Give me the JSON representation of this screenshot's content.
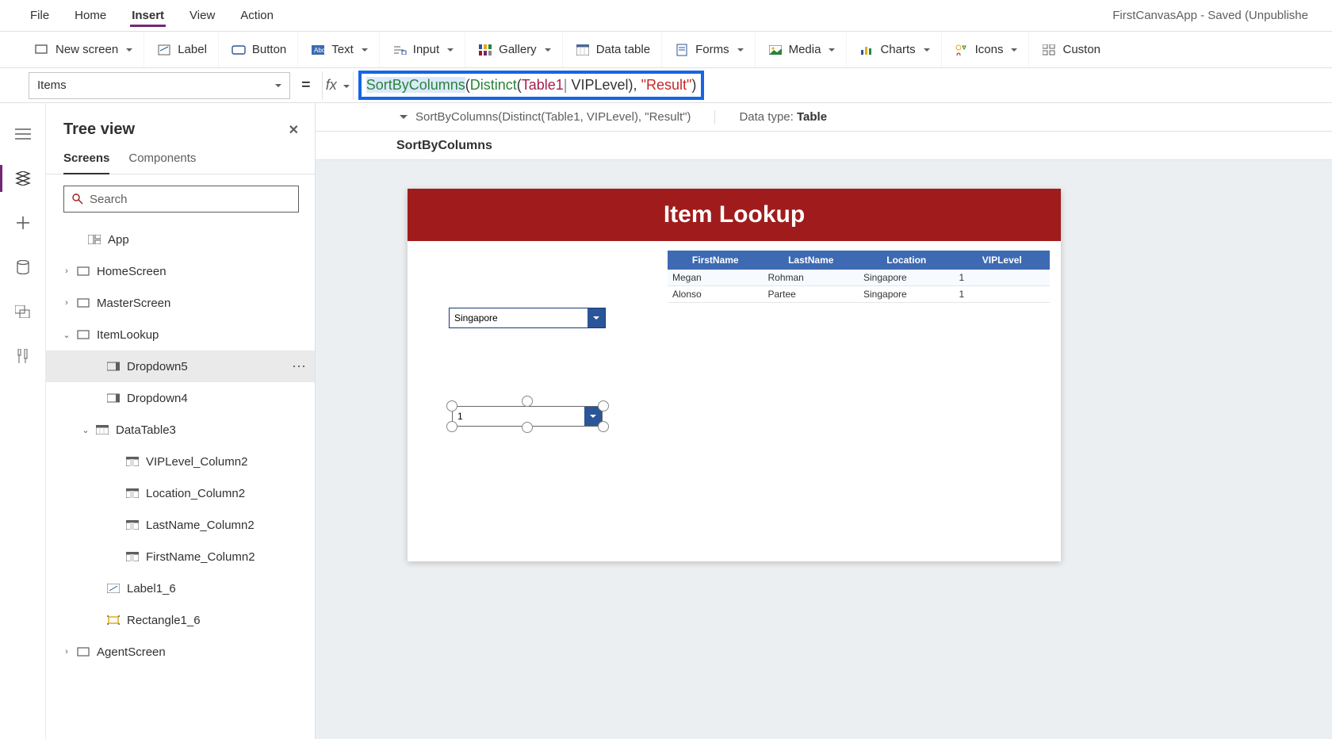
{
  "app": {
    "title": "FirstCanvasApp - Saved (Unpublishe"
  },
  "menu": {
    "items": [
      {
        "label": "File"
      },
      {
        "label": "Home"
      },
      {
        "label": "Insert",
        "active": true
      },
      {
        "label": "View"
      },
      {
        "label": "Action"
      }
    ]
  },
  "ribbon": {
    "newScreen": "New screen",
    "label": "Label",
    "button": "Button",
    "text": "Text",
    "input": "Input",
    "gallery": "Gallery",
    "dataTable": "Data table",
    "forms": "Forms",
    "media": "Media",
    "charts": "Charts",
    "icons": "Icons",
    "custom": "Custon"
  },
  "formulaBar": {
    "property": "Items",
    "tokens": {
      "fn1": "SortByColumns",
      "p1": "(",
      "fn2": "Distinct",
      "p2": "(",
      "tbl": "Table1",
      "comma1": ",",
      "cursor": " ",
      "fld": "VIPLevel",
      "p3": ")",
      "comma2": ", ",
      "str": "\"Result\"",
      "p4": ")"
    },
    "statusText": "SortByColumns(Distinct(Table1, VIPLevel), \"Result\")",
    "dataTypeLabel": "Data type: ",
    "dataTypeVal": "Table",
    "functionName": "SortByColumns"
  },
  "tree": {
    "title": "Tree view",
    "tabs": [
      {
        "label": "Screens",
        "active": true
      },
      {
        "label": "Components"
      }
    ],
    "searchPlaceholder": "Search",
    "nodes": [
      {
        "indent": 18,
        "chev": "",
        "icon": "app",
        "label": "App"
      },
      {
        "indent": 4,
        "chev": "›",
        "icon": "screen",
        "label": "HomeScreen"
      },
      {
        "indent": 4,
        "chev": "›",
        "icon": "screen",
        "label": "MasterScreen"
      },
      {
        "indent": 4,
        "chev": "⌄",
        "icon": "screen",
        "label": "ItemLookup"
      },
      {
        "indent": 42,
        "chev": "",
        "icon": "dropdown",
        "label": "Dropdown5",
        "selected": true,
        "more": true
      },
      {
        "indent": 42,
        "chev": "",
        "icon": "dropdown",
        "label": "Dropdown4"
      },
      {
        "indent": 28,
        "chev": "⌄",
        "icon": "table",
        "label": "DataTable3"
      },
      {
        "indent": 66,
        "chev": "",
        "icon": "column",
        "label": "VIPLevel_Column2"
      },
      {
        "indent": 66,
        "chev": "",
        "icon": "column",
        "label": "Location_Column2"
      },
      {
        "indent": 66,
        "chev": "",
        "icon": "column",
        "label": "LastName_Column2"
      },
      {
        "indent": 66,
        "chev": "",
        "icon": "column",
        "label": "FirstName_Column2"
      },
      {
        "indent": 42,
        "chev": "",
        "icon": "label",
        "label": "Label1_6"
      },
      {
        "indent": 42,
        "chev": "",
        "icon": "rect",
        "label": "Rectangle1_6"
      },
      {
        "indent": 4,
        "chev": "›",
        "icon": "screen",
        "label": "AgentScreen"
      }
    ]
  },
  "canvas": {
    "bannerTitle": "Item Lookup",
    "dropdown1Value": "Singapore",
    "dropdown2Value": "1",
    "table": {
      "headers": [
        "FirstName",
        "LastName",
        "Location",
        "VIPLevel"
      ],
      "rows": [
        [
          "Megan",
          "Rohman",
          "Singapore",
          "1"
        ],
        [
          "Alonso",
          "Partee",
          "Singapore",
          "1"
        ]
      ]
    }
  }
}
